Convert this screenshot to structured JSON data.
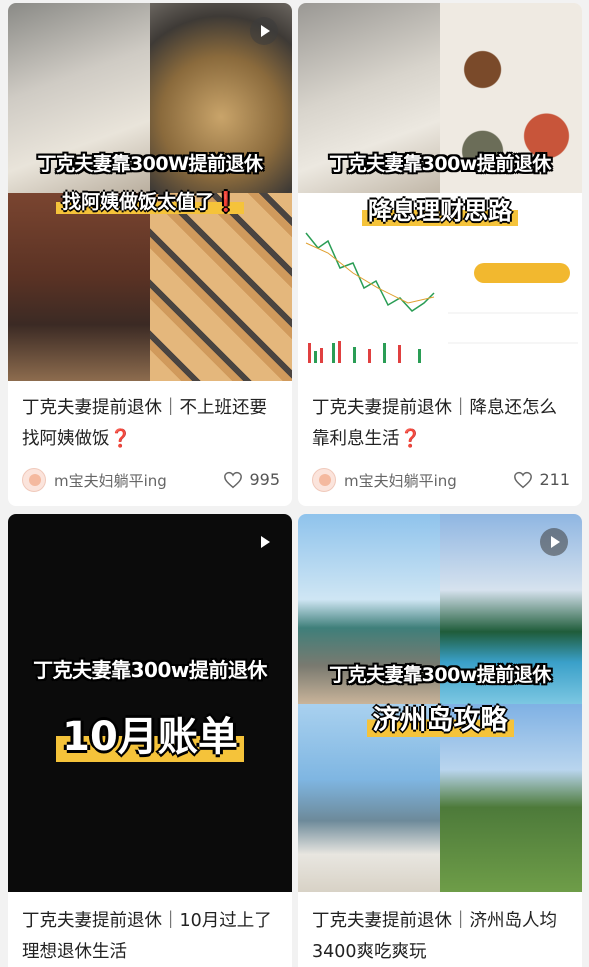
{
  "feed": {
    "cards": [
      {
        "cover_title": "丁克夫妻靠300W提前退休",
        "cover_subtitle": "找阿姨做饭太值了❗",
        "title_text": "丁克夫妻提前退休｜不上班还要找阿姨做饭",
        "title_mark": "❓",
        "author": "m宝夫妇躺平ing",
        "likes": "995",
        "has_video": true
      },
      {
        "cover_title": "丁克夫妻靠300w提前退休",
        "cover_subtitle": "降息理财思路",
        "title_text": "丁克夫妻提前退休｜降息还怎么靠利息生活",
        "title_mark": "❓",
        "author": "m宝夫妇躺平ing",
        "likes": "211",
        "has_video": false
      },
      {
        "cover_title": "丁克夫妻靠300w提前退休",
        "cover_subtitle": "10月账单",
        "title_text": "丁克夫妻提前退休｜10月过上了理想退休生活",
        "title_mark": "",
        "has_video": true
      },
      {
        "cover_title": "丁克夫妻靠300w提前退休",
        "cover_subtitle": "济州岛攻略",
        "title_text": "丁克夫妻提前退休｜济州岛人均3400爽吃爽玩",
        "title_mark": "",
        "has_video": true
      }
    ]
  },
  "colors": {
    "highlight": "#f5c33a",
    "question_mark": "#e03a3a",
    "card_bg": "#ffffff",
    "page_bg": "#f2f2f2"
  },
  "icons": {
    "play": "play-icon",
    "like": "heart-icon",
    "avatar": "avatar"
  }
}
